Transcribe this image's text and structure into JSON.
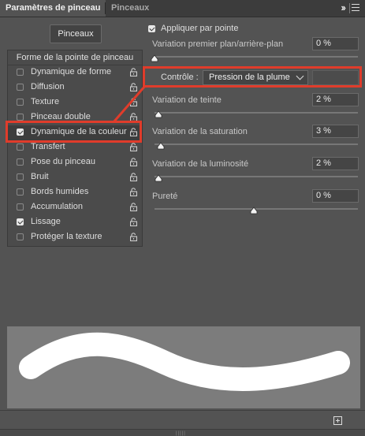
{
  "tabs": [
    {
      "label": "Paramètres de pinceau",
      "active": true
    },
    {
      "label": "Pinceaux",
      "active": false
    }
  ],
  "header_icons": [
    "collapse-icon",
    "panel-menu-icon"
  ],
  "presets_button": "Pinceaux",
  "list": {
    "header": "Forme de la pointe de pinceau",
    "items": [
      {
        "label": "Dynamique de forme",
        "checked": false
      },
      {
        "label": "Diffusion",
        "checked": false
      },
      {
        "label": "Texture",
        "checked": false
      },
      {
        "label": "Pinceau double",
        "checked": false
      },
      {
        "label": "Dynamique de la couleur",
        "checked": true,
        "selected": true
      },
      {
        "label": "Transfert",
        "checked": false
      },
      {
        "label": "Pose du pinceau",
        "checked": false
      },
      {
        "label": "Bruit",
        "checked": false
      },
      {
        "label": "Bords humides",
        "checked": false
      },
      {
        "label": "Accumulation",
        "checked": false
      },
      {
        "label": "Lissage",
        "checked": true
      },
      {
        "label": "Protéger la texture",
        "checked": false
      }
    ]
  },
  "settings": {
    "apply_per_tip": {
      "label": "Appliquer par pointe",
      "checked": true
    },
    "fg_bg": {
      "label": "Variation premier plan/arrière-plan",
      "value": "0 %",
      "level": 0.0
    },
    "control": {
      "label": "Contrôle :",
      "value": "Pression de la plume"
    },
    "hue": {
      "label": "Variation de teinte",
      "value": "2 %",
      "level": 0.02
    },
    "saturation": {
      "label": "Variation de la saturation",
      "value": "3 %",
      "level": 0.03
    },
    "brightness": {
      "label": "Variation de la luminosité",
      "value": "2 %",
      "level": 0.02
    },
    "purity": {
      "label": "Pureté",
      "value": "0 %",
      "level": 0.5
    }
  },
  "colors": {
    "highlight": "#e03c2b",
    "panel": "#535353",
    "tabbar": "#3c3c3c",
    "preview_bg": "#7c7c7c",
    "stroke": "#ffffff"
  },
  "footer_icons": [
    "new-brush-icon"
  ]
}
